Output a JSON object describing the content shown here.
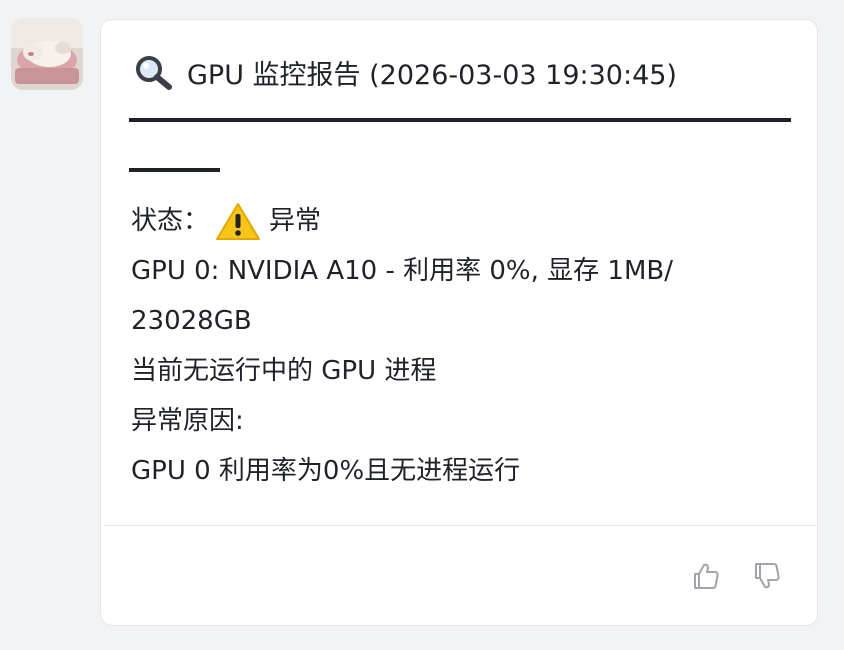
{
  "report": {
    "title": "GPU 监控报告 (2026-03-03 19:30:45)",
    "status_label": "状态：",
    "status_value": "异常",
    "gpu_line": "GPU 0: NVIDIA A10 - 利用率 0%, 显存 1MB/",
    "gpu_line_cont": "23028GB",
    "process_line": "当前无运行中的 GPU 进程",
    "reason_label": "异常原因:",
    "reason_text": "GPU 0 利用率为0%且无进程运行"
  },
  "icons": {
    "title_icon": "magnifying-glass-icon",
    "status_icon": "warning-icon",
    "like": "thumbs-up-icon",
    "dislike": "thumbs-down-icon"
  },
  "colors": {
    "background": "#f2f3f5",
    "card": "#ffffff",
    "warning": "#f5c518",
    "icon_gray": "#a0a4ab"
  }
}
